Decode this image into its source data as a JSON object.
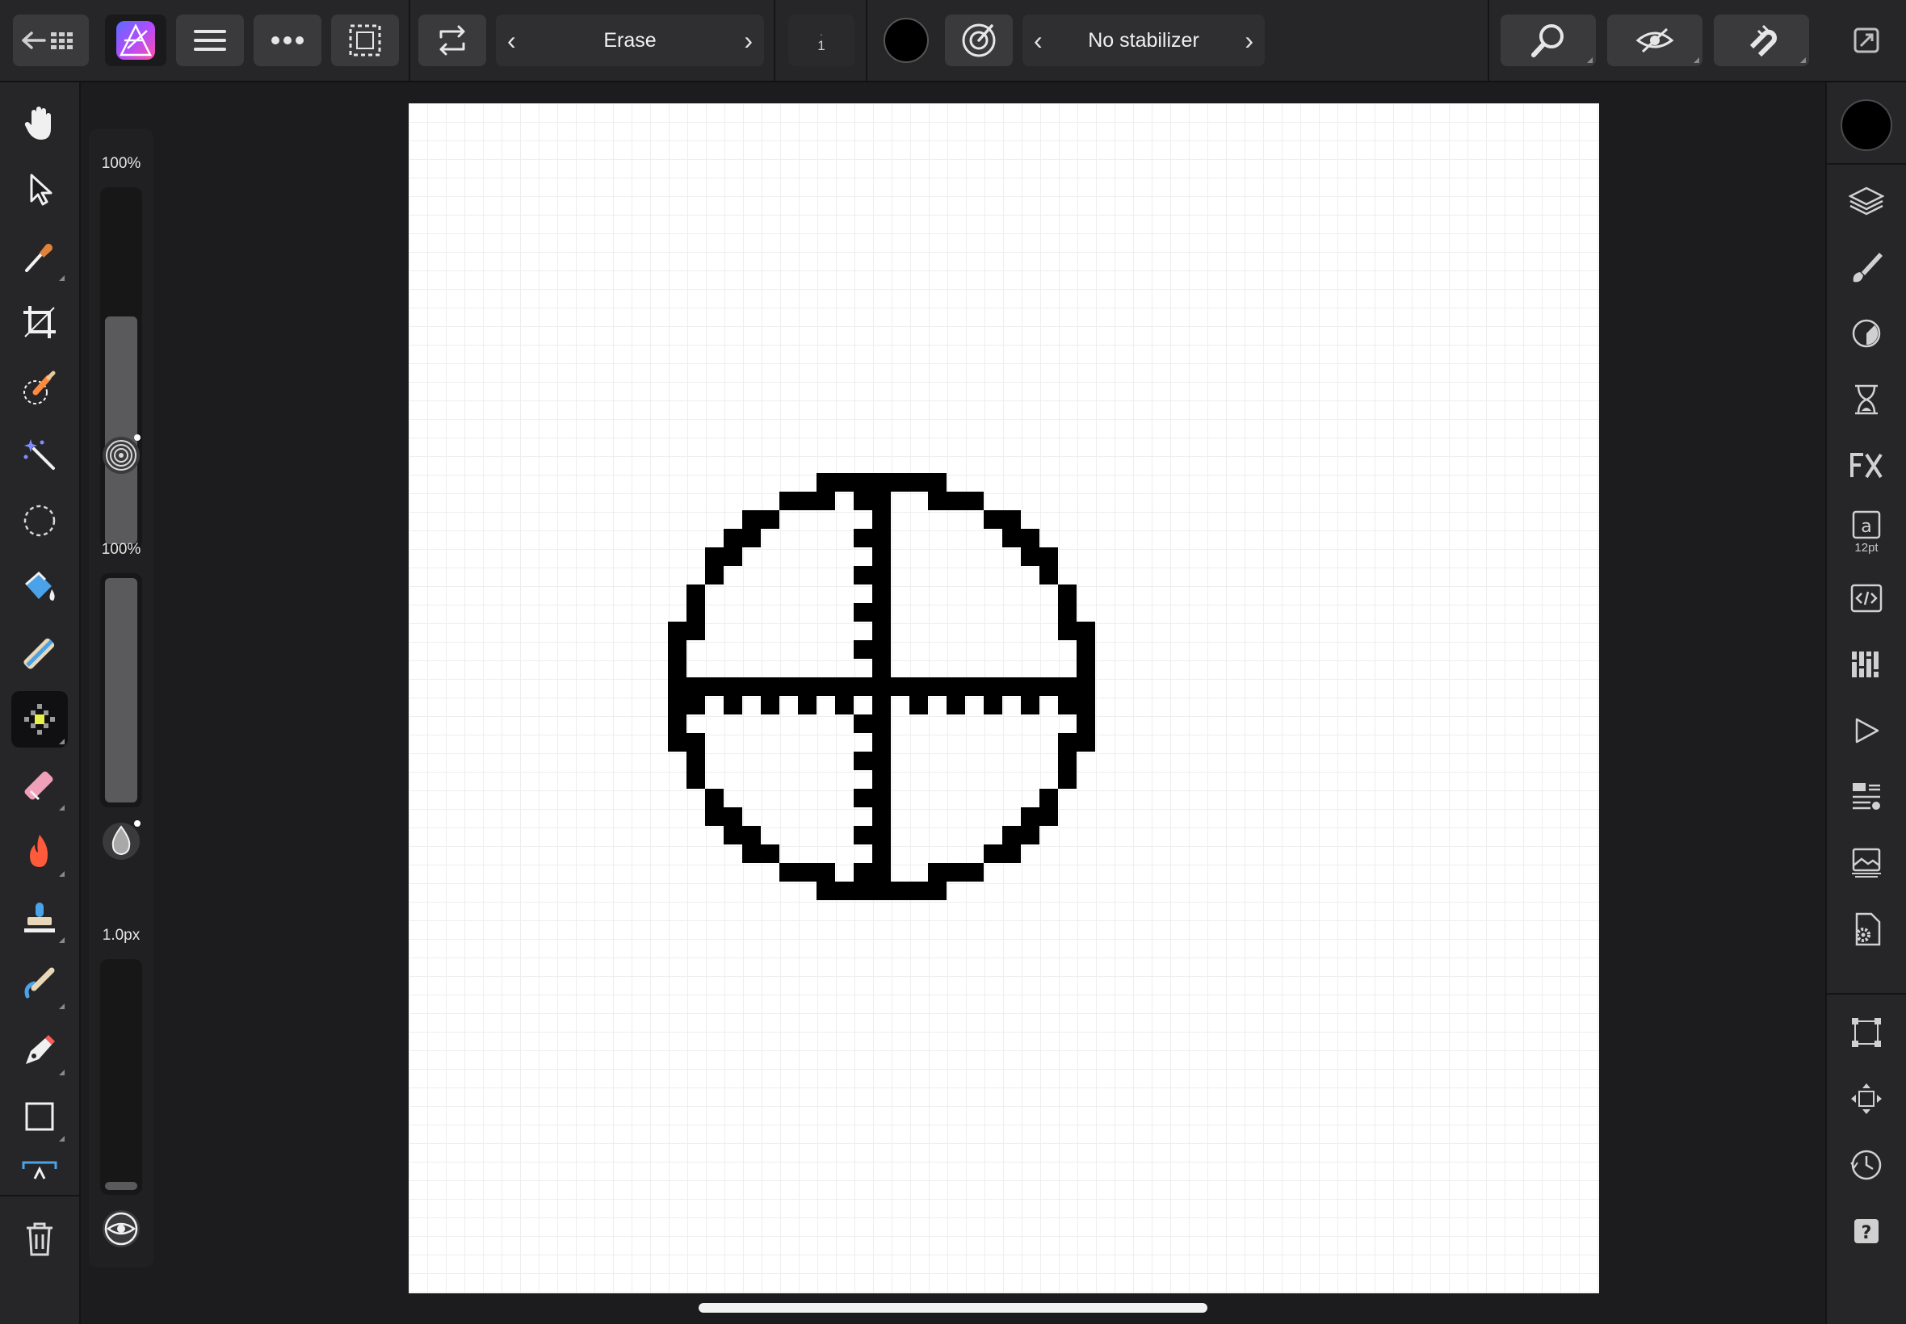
{
  "toolbar": {
    "brush_name": "Erase",
    "brush_size_top": ".",
    "brush_size_value": "1",
    "stabilizer": "No stabilizer",
    "primary_color": "#000000"
  },
  "context_panel": {
    "opacity_label": "100%",
    "opacity_value": 1.0,
    "flow_label": "100%",
    "flow_value": 1.0,
    "width_label": "1.0px",
    "width_value": 0.02
  },
  "right_panel": {
    "text_studio_label": "12pt"
  },
  "colors": {
    "accent": "#a259ff",
    "background": "#1c1c1e",
    "canvas": "#ffffff",
    "pixel_art": "#000000"
  }
}
